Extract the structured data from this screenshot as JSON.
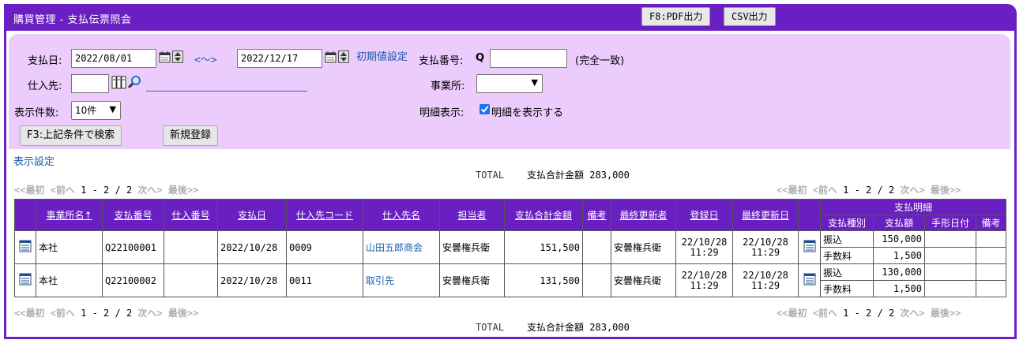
{
  "title": "購買管理 - 支払伝票照会",
  "toolbar": {
    "pdf_label": "F8:PDF出力",
    "csv_label": "CSV出力"
  },
  "search": {
    "date_label": "支払日:",
    "date_from": "2022/08/01",
    "range_sep": "<～>",
    "date_to": "2022/12/17",
    "reset_label": "初期値設定",
    "payno_label": "支払番号:",
    "payno_prefix": "Q",
    "payno_value": "",
    "exact_label": "(完全一致)",
    "supplier_label": "仕入先:",
    "supplier_code": "",
    "office_label": "事業所:",
    "office_value": "",
    "count_label": "表示件数:",
    "count_value": "10件",
    "detail_label": "明細表示:",
    "detail_check_label": "明細を表示する",
    "detail_checked": true,
    "search_button": "F3:上記条件で検索",
    "new_button": "新規登録"
  },
  "display_settings": "表示設定",
  "total_line": {
    "label": "TOTAL",
    "amount_label": "支払合計金額",
    "amount": "283,000"
  },
  "pager": {
    "first": "<<最初",
    "prev": "<前へ",
    "page": "1 - 2 / 2",
    "next": "次へ>",
    "last": "最後>>"
  },
  "table": {
    "headers": [
      "事業所名↑",
      "支払番号",
      "仕入番号",
      "支払日",
      "仕入先コード",
      "仕入先名",
      "担当者",
      "支払合計金額",
      "備考",
      "最終更新者",
      "登録日",
      "最終更新日"
    ],
    "detail_header": "支払明細",
    "detail_subheaders": [
      "支払種別",
      "支払額",
      "手形日付",
      "備考"
    ],
    "rows": [
      {
        "office": "本社",
        "pay_no": "Q22100001",
        "purchase_no": "",
        "pay_date": "2022/10/28",
        "supplier_code": "0009",
        "supplier_name": "山田五郎商会",
        "staff": "安曇権兵衛",
        "amount": "151,500",
        "note": "",
        "updater": "安曇権兵衛",
        "reg_date": "22/10/28",
        "reg_time": "11:29",
        "upd_date": "22/10/28",
        "upd_time": "11:29",
        "details": [
          {
            "type": "振込",
            "amount": "150,000",
            "bill_date": "",
            "note": ""
          },
          {
            "type": "手数料",
            "amount": "1,500",
            "bill_date": "",
            "note": ""
          }
        ]
      },
      {
        "office": "本社",
        "pay_no": "Q22100002",
        "purchase_no": "",
        "pay_date": "2022/10/28",
        "supplier_code": "0011",
        "supplier_name": "取引先",
        "staff": "安曇権兵衛",
        "amount": "131,500",
        "note": "",
        "updater": "安曇権兵衛",
        "reg_date": "22/10/28",
        "reg_time": "11:29",
        "upd_date": "22/10/28",
        "upd_time": "11:29",
        "details": [
          {
            "type": "振込",
            "amount": "130,000",
            "bill_date": "",
            "note": ""
          },
          {
            "type": "手数料",
            "amount": "1,500",
            "bill_date": "",
            "note": ""
          }
        ]
      }
    ]
  }
}
